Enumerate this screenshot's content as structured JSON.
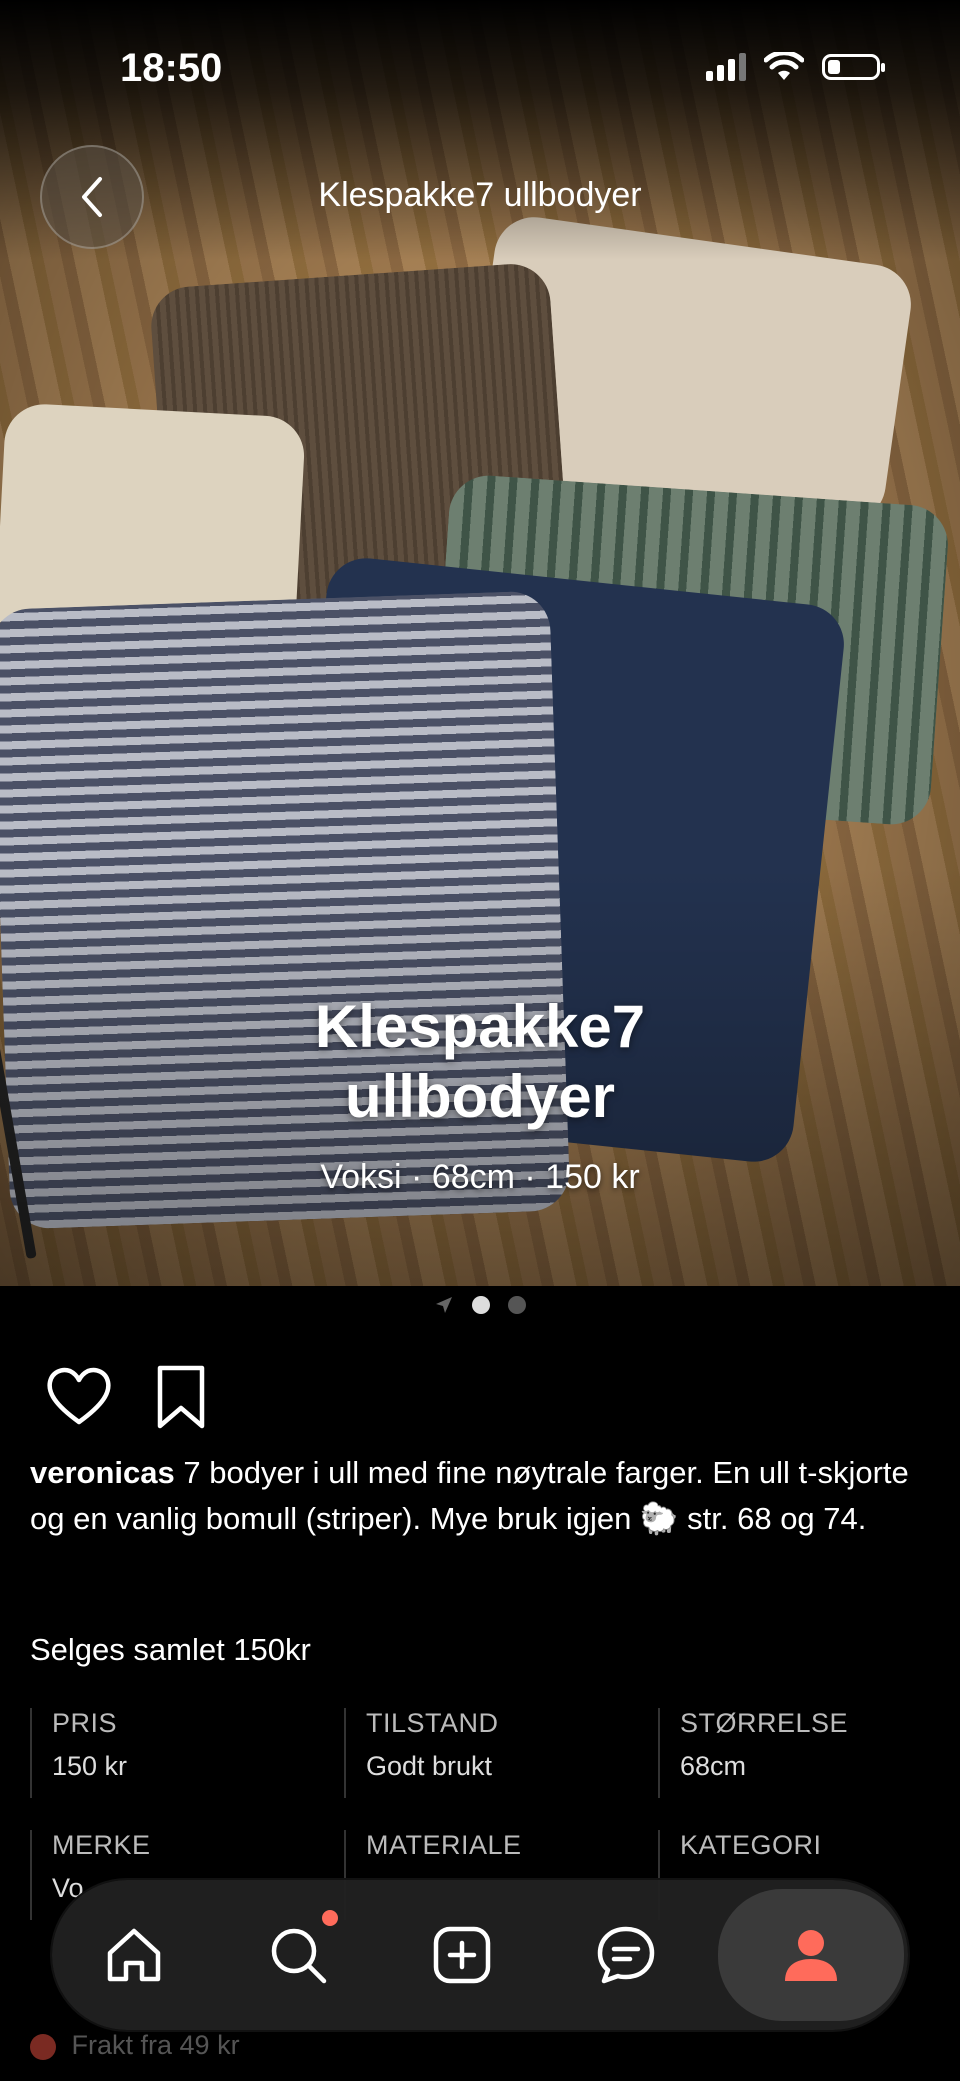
{
  "status": {
    "time": "18:50"
  },
  "header": {
    "title": "Klespakke7 ullbodyer"
  },
  "hero": {
    "title_line1": "Klespakke7",
    "title_line2": "ullbodyer",
    "subtitle": "Voksi · 68cm · 150 kr"
  },
  "pager": {
    "count": 2,
    "active": 1
  },
  "post": {
    "username": "veronicas",
    "text": "7 bodyer i ull med fine nøytrale farger.  En ull t-skjorte og en vanlig bomull (striper). Mye bruk igjen 🐑  str. 68 og 74.",
    "text2": "Selges samlet 150kr"
  },
  "specs": [
    {
      "key": "PRIS",
      "value": "150 kr"
    },
    {
      "key": "TILSTAND",
      "value": "Godt brukt"
    },
    {
      "key": "STØRRELSE",
      "value": "68cm"
    },
    {
      "key": "MERKE",
      "value": "Vo"
    },
    {
      "key": "MATERIALE",
      "value": ""
    },
    {
      "key": "KATEGORI",
      "value": ""
    }
  ],
  "shipping": {
    "text": "Frakt fra 49 kr"
  },
  "nav": {
    "items": [
      "home-icon",
      "search-icon",
      "add-icon",
      "chat-icon",
      "profile-icon"
    ],
    "active_color": "#ff6b5b"
  }
}
